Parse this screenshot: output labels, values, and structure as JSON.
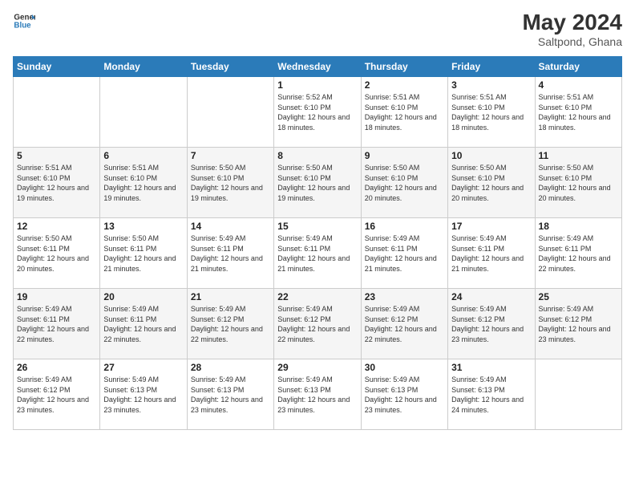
{
  "header": {
    "logo_line1": "General",
    "logo_line2": "Blue",
    "title": "May 2024",
    "location": "Saltpond, Ghana"
  },
  "days_of_week": [
    "Sunday",
    "Monday",
    "Tuesday",
    "Wednesday",
    "Thursday",
    "Friday",
    "Saturday"
  ],
  "weeks": [
    [
      {
        "day": "",
        "info": ""
      },
      {
        "day": "",
        "info": ""
      },
      {
        "day": "",
        "info": ""
      },
      {
        "day": "1",
        "info": "Sunrise: 5:52 AM\nSunset: 6:10 PM\nDaylight: 12 hours and 18 minutes."
      },
      {
        "day": "2",
        "info": "Sunrise: 5:51 AM\nSunset: 6:10 PM\nDaylight: 12 hours and 18 minutes."
      },
      {
        "day": "3",
        "info": "Sunrise: 5:51 AM\nSunset: 6:10 PM\nDaylight: 12 hours and 18 minutes."
      },
      {
        "day": "4",
        "info": "Sunrise: 5:51 AM\nSunset: 6:10 PM\nDaylight: 12 hours and 18 minutes."
      }
    ],
    [
      {
        "day": "5",
        "info": "Sunrise: 5:51 AM\nSunset: 6:10 PM\nDaylight: 12 hours and 19 minutes."
      },
      {
        "day": "6",
        "info": "Sunrise: 5:51 AM\nSunset: 6:10 PM\nDaylight: 12 hours and 19 minutes."
      },
      {
        "day": "7",
        "info": "Sunrise: 5:50 AM\nSunset: 6:10 PM\nDaylight: 12 hours and 19 minutes."
      },
      {
        "day": "8",
        "info": "Sunrise: 5:50 AM\nSunset: 6:10 PM\nDaylight: 12 hours and 19 minutes."
      },
      {
        "day": "9",
        "info": "Sunrise: 5:50 AM\nSunset: 6:10 PM\nDaylight: 12 hours and 20 minutes."
      },
      {
        "day": "10",
        "info": "Sunrise: 5:50 AM\nSunset: 6:10 PM\nDaylight: 12 hours and 20 minutes."
      },
      {
        "day": "11",
        "info": "Sunrise: 5:50 AM\nSunset: 6:10 PM\nDaylight: 12 hours and 20 minutes."
      }
    ],
    [
      {
        "day": "12",
        "info": "Sunrise: 5:50 AM\nSunset: 6:11 PM\nDaylight: 12 hours and 20 minutes."
      },
      {
        "day": "13",
        "info": "Sunrise: 5:50 AM\nSunset: 6:11 PM\nDaylight: 12 hours and 21 minutes."
      },
      {
        "day": "14",
        "info": "Sunrise: 5:49 AM\nSunset: 6:11 PM\nDaylight: 12 hours and 21 minutes."
      },
      {
        "day": "15",
        "info": "Sunrise: 5:49 AM\nSunset: 6:11 PM\nDaylight: 12 hours and 21 minutes."
      },
      {
        "day": "16",
        "info": "Sunrise: 5:49 AM\nSunset: 6:11 PM\nDaylight: 12 hours and 21 minutes."
      },
      {
        "day": "17",
        "info": "Sunrise: 5:49 AM\nSunset: 6:11 PM\nDaylight: 12 hours and 21 minutes."
      },
      {
        "day": "18",
        "info": "Sunrise: 5:49 AM\nSunset: 6:11 PM\nDaylight: 12 hours and 22 minutes."
      }
    ],
    [
      {
        "day": "19",
        "info": "Sunrise: 5:49 AM\nSunset: 6:11 PM\nDaylight: 12 hours and 22 minutes."
      },
      {
        "day": "20",
        "info": "Sunrise: 5:49 AM\nSunset: 6:11 PM\nDaylight: 12 hours and 22 minutes."
      },
      {
        "day": "21",
        "info": "Sunrise: 5:49 AM\nSunset: 6:12 PM\nDaylight: 12 hours and 22 minutes."
      },
      {
        "day": "22",
        "info": "Sunrise: 5:49 AM\nSunset: 6:12 PM\nDaylight: 12 hours and 22 minutes."
      },
      {
        "day": "23",
        "info": "Sunrise: 5:49 AM\nSunset: 6:12 PM\nDaylight: 12 hours and 22 minutes."
      },
      {
        "day": "24",
        "info": "Sunrise: 5:49 AM\nSunset: 6:12 PM\nDaylight: 12 hours and 23 minutes."
      },
      {
        "day": "25",
        "info": "Sunrise: 5:49 AM\nSunset: 6:12 PM\nDaylight: 12 hours and 23 minutes."
      }
    ],
    [
      {
        "day": "26",
        "info": "Sunrise: 5:49 AM\nSunset: 6:12 PM\nDaylight: 12 hours and 23 minutes."
      },
      {
        "day": "27",
        "info": "Sunrise: 5:49 AM\nSunset: 6:13 PM\nDaylight: 12 hours and 23 minutes."
      },
      {
        "day": "28",
        "info": "Sunrise: 5:49 AM\nSunset: 6:13 PM\nDaylight: 12 hours and 23 minutes."
      },
      {
        "day": "29",
        "info": "Sunrise: 5:49 AM\nSunset: 6:13 PM\nDaylight: 12 hours and 23 minutes."
      },
      {
        "day": "30",
        "info": "Sunrise: 5:49 AM\nSunset: 6:13 PM\nDaylight: 12 hours and 23 minutes."
      },
      {
        "day": "31",
        "info": "Sunrise: 5:49 AM\nSunset: 6:13 PM\nDaylight: 12 hours and 24 minutes."
      },
      {
        "day": "",
        "info": ""
      }
    ]
  ]
}
